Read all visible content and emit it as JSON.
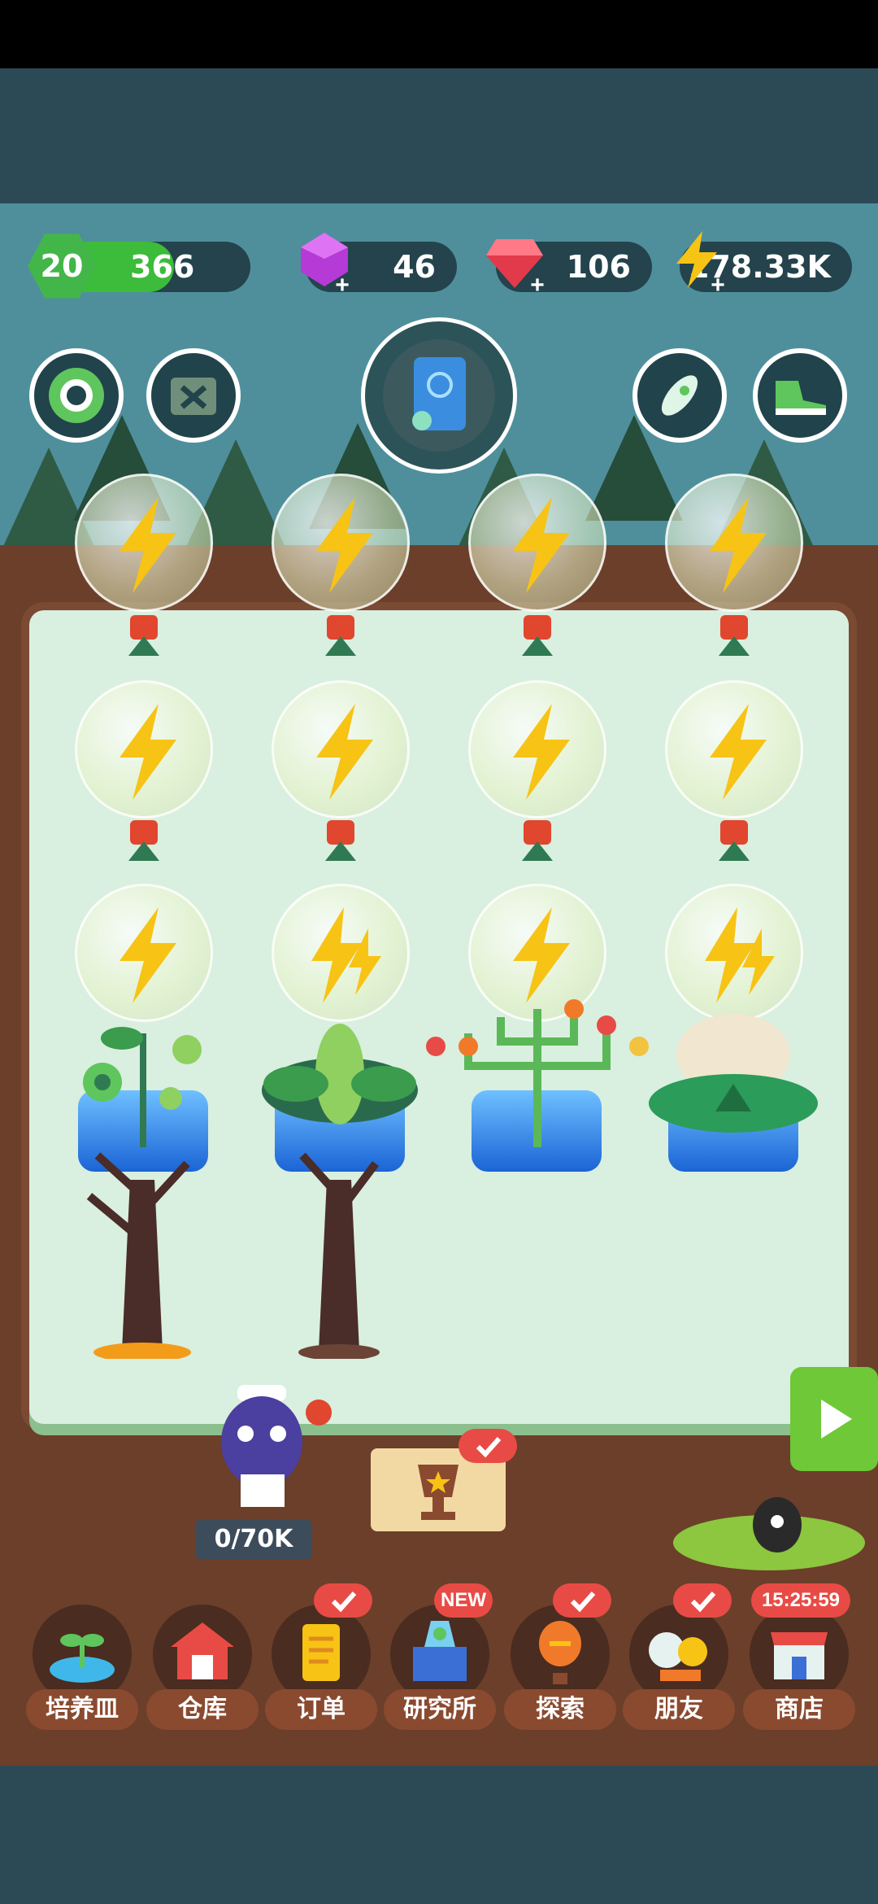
{
  "header": {
    "level": "20",
    "xp": "366",
    "xp_fraction": 0.65,
    "gems_purple": "46",
    "gems_red": "106",
    "energy": "178.33K"
  },
  "icons": {
    "settings": "gear-icon",
    "ad_remove": "no-ads-icon",
    "codex": "book-icon",
    "rocket": "rocket-icon",
    "shoe": "sneaker-icon",
    "energy": "lightning-bolt-icon"
  },
  "board": {
    "collector_progress": "0/70K",
    "next_label": "play-arrow-icon"
  },
  "nav": {
    "items": [
      {
        "label": "培养皿",
        "icon": "sprout-dish-icon",
        "badge": ""
      },
      {
        "label": "仓库",
        "icon": "warehouse-icon",
        "badge": ""
      },
      {
        "label": "订单",
        "icon": "order-scroll-icon",
        "badge": "check"
      },
      {
        "label": "研究所",
        "icon": "lab-icon",
        "badge": "NEW"
      },
      {
        "label": "探索",
        "icon": "balloon-icon",
        "badge": "check"
      },
      {
        "label": "朋友",
        "icon": "friends-icon",
        "badge": "check"
      },
      {
        "label": "商店",
        "icon": "shop-icon",
        "badge": "15:25:59"
      }
    ]
  },
  "colors": {
    "accent_green": "#3dbb3a",
    "badge_red": "#e84b45",
    "board_bg": "#d9efdf",
    "soil": "#6b3f2a"
  }
}
